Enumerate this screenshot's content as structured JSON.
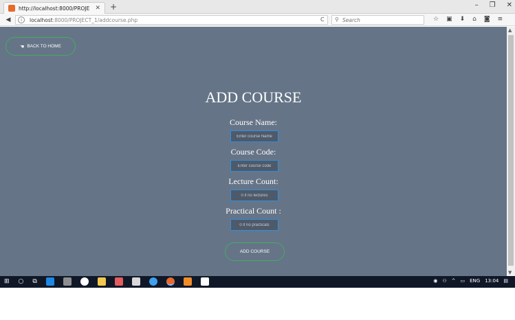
{
  "browser": {
    "tab_title": "http://localhost:8000/PROJE",
    "tab_close": "✕",
    "new_tab": "+",
    "window_controls": [
      "–",
      "❐",
      "✕"
    ],
    "url_host": "localhost",
    "url_path": ":8000/PROJECT_1/addcourse.php",
    "reload": "C",
    "search_placeholder": "Search",
    "toolbar_icons": [
      "star-icon",
      "reading-list-icon",
      "download-icon",
      "home-icon",
      "pocket-icon",
      "menu-icon"
    ]
  },
  "page": {
    "back_home_label": "BACK TO HOME",
    "title": "ADD COURSE",
    "fields": [
      {
        "label": "Course Name:",
        "placeholder": "Enter course Name"
      },
      {
        "label": "Course Code:",
        "placeholder": "Enter course code"
      },
      {
        "label": "Lecture Count:",
        "placeholder": "0 if no lectures"
      },
      {
        "label": "Practical Count :",
        "placeholder": "0 if no practicals"
      }
    ],
    "submit_label": "ADD COURSE",
    "colors": {
      "background": "#667487",
      "accent_border": "#3fae62",
      "input_border": "#2f8fe0"
    }
  },
  "taskbar": {
    "apps": [
      "start-icon",
      "search-icon",
      "task-view-icon",
      "edge-icon",
      "app-icon",
      "app-icon",
      "file-explorer-icon",
      "app-icon",
      "app-icon",
      "app-icon",
      "firefox-icon",
      "app-icon",
      "photos-icon"
    ],
    "language": "ENG",
    "time": "13:04"
  }
}
